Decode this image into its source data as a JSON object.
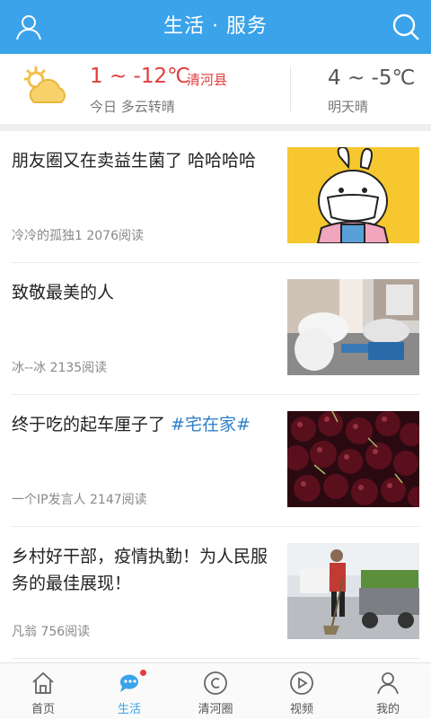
{
  "header": {
    "title": "生活 · 服务",
    "left_icon": "user-icon",
    "right_icon": "search-icon",
    "bg": "#3aa3ea"
  },
  "weather": {
    "today_temp": "1 ~ -12℃",
    "county": "清河县",
    "today_desc": "今日 多云转晴",
    "tomorrow_temp": "4 ~ -5℃",
    "tomorrow_desc": "明天晴",
    "icon": "partly-cloudy-icon"
  },
  "feed": [
    {
      "title": "朋友圈又在卖益生菌了 哈哈哈哈",
      "tag": "",
      "meta": "冷冷的孤独1 2076阅读",
      "thumb": "bunny-mask-illustration"
    },
    {
      "title": "致敬最美的人",
      "tag": "",
      "meta": "冰--冰 2135阅读",
      "thumb": "medical-workers-resting-photo"
    },
    {
      "title": "终于吃的起车厘子了 ",
      "tag": "#宅在家#",
      "meta": "一个IP发言人 2147阅读",
      "thumb": "cherries-photo"
    },
    {
      "title": "乡村好干部，疫情执勤！为人民服务的最佳展现！",
      "tag": "",
      "meta": "凡翁 756阅读",
      "thumb": "village-officer-sweeping-photo"
    }
  ],
  "tabs": [
    {
      "label": "首页",
      "icon": "home-icon"
    },
    {
      "label": "生活",
      "icon": "chat-bubble-icon",
      "active": true
    },
    {
      "label": "清河圈",
      "icon": "copyright-circle-icon"
    },
    {
      "label": "视频",
      "icon": "play-circle-icon"
    },
    {
      "label": "我的",
      "icon": "profile-icon"
    }
  ],
  "colors": {
    "accent": "#3aa3ea",
    "temp_red": "#e23c3c",
    "tag_blue": "#2f7fc7"
  }
}
